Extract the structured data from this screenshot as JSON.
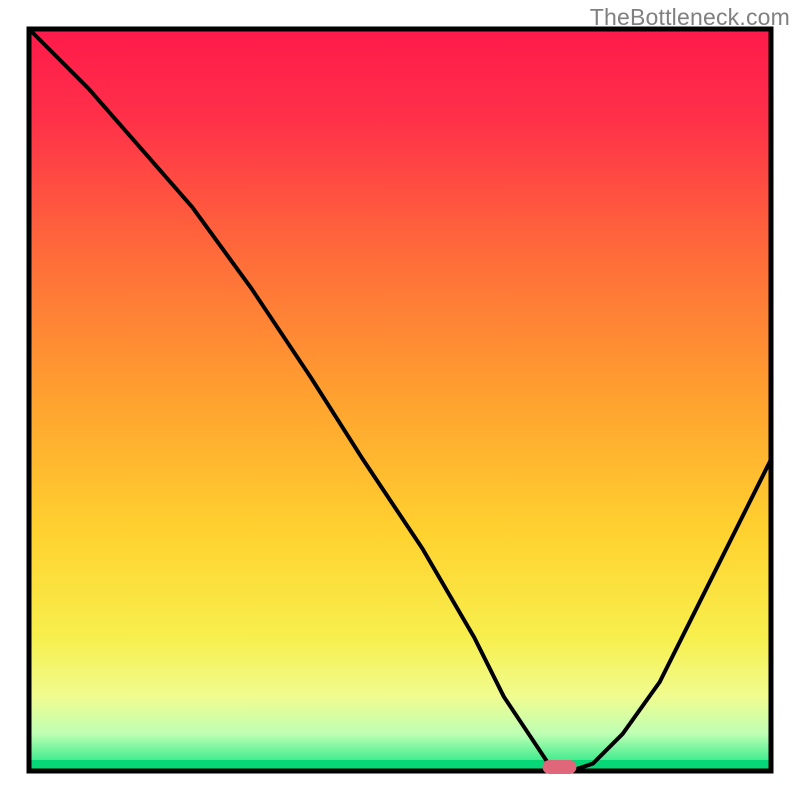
{
  "watermark": "TheBottleneck.com",
  "chart_data": {
    "type": "line",
    "title": "",
    "xlabel": "",
    "ylabel": "",
    "xlim": [
      0,
      100
    ],
    "ylim": [
      0,
      100
    ],
    "x": [
      0,
      8,
      15,
      22,
      30,
      38,
      45,
      53,
      60,
      64,
      68,
      70,
      73,
      76,
      80,
      85,
      90,
      95,
      100
    ],
    "y": [
      100,
      92,
      84,
      76,
      65,
      53,
      42,
      30,
      18,
      10,
      4,
      1,
      0,
      1,
      5,
      12,
      22,
      32,
      42
    ],
    "optimal_marker": {
      "x": 71.5,
      "y": 0
    }
  }
}
